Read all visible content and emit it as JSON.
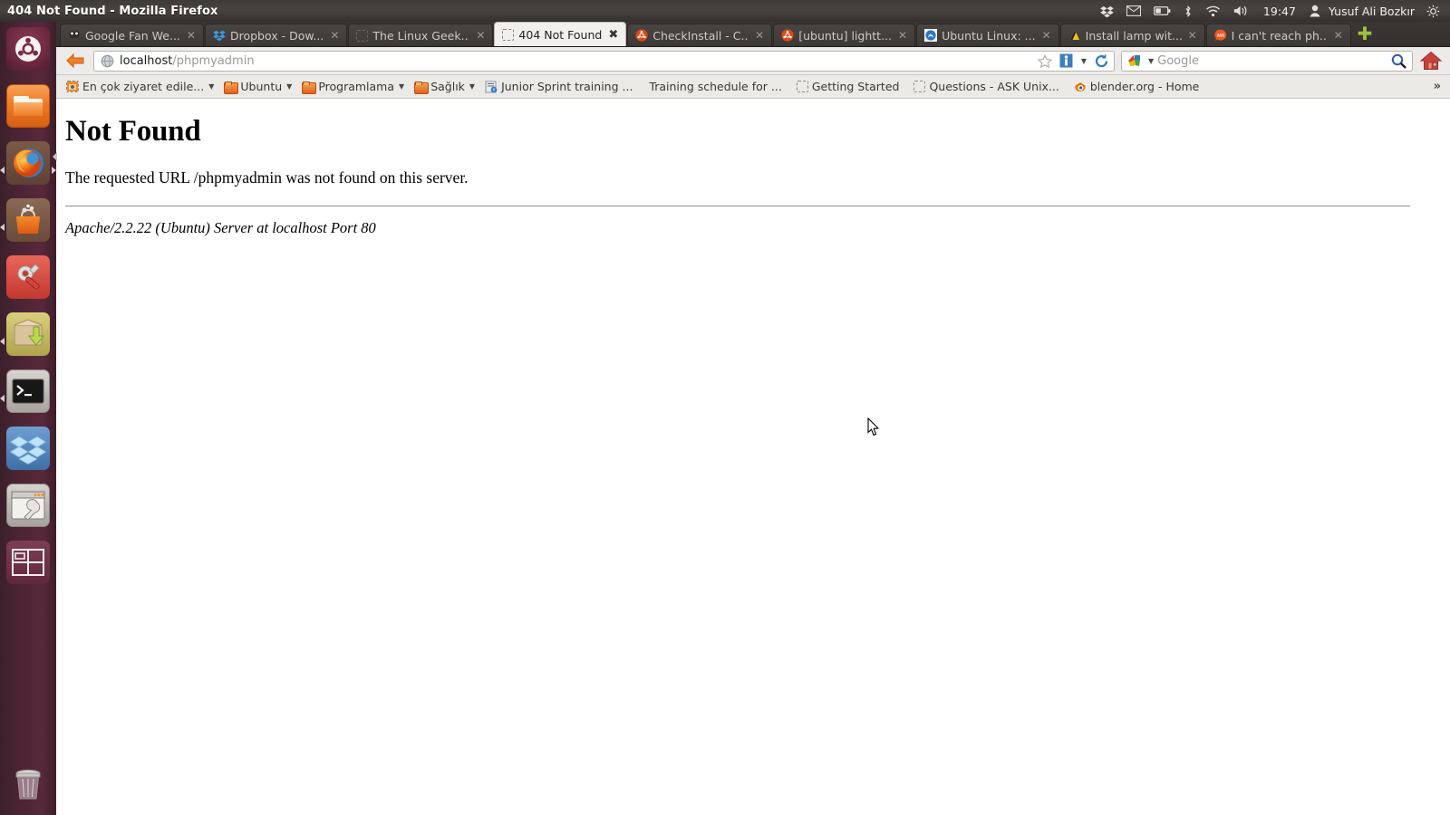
{
  "window": {
    "title": "404 Not Found - Mozilla Firefox"
  },
  "top_panel": {
    "clock": "19:47",
    "user": "Yusuf Ali Bozkır",
    "tray_icons": [
      {
        "name": "dropbox-icon",
        "glyph": "dropbox"
      },
      {
        "name": "mail-icon",
        "glyph": "envelope"
      },
      {
        "name": "battery-icon",
        "glyph": "battery"
      },
      {
        "name": "bluetooth-icon",
        "glyph": "bluetooth"
      },
      {
        "name": "wifi-icon",
        "glyph": "wifi"
      },
      {
        "name": "volume-icon",
        "glyph": "speaker"
      }
    ],
    "session_icon": "gear-icon",
    "user_icon": "user-icon"
  },
  "launcher": {
    "items": [
      {
        "name": "ubuntu-dash-icon",
        "label": "Dash home",
        "running": false
      },
      {
        "name": "files-icon",
        "label": "Files",
        "running": false
      },
      {
        "name": "firefox-icon",
        "label": "Firefox Web Browser",
        "running": true
      },
      {
        "name": "software-center-icon",
        "label": "Ubuntu Software Center",
        "running": true
      },
      {
        "name": "system-settings-icon",
        "label": "System Settings",
        "running": false
      },
      {
        "name": "ubuntu-one-icon",
        "label": "Ubuntu One",
        "running": true
      },
      {
        "name": "terminal-icon",
        "label": "Terminal",
        "running": true
      },
      {
        "name": "dropbox-icon",
        "label": "Dropbox",
        "running": false
      },
      {
        "name": "synaptic-icon",
        "label": "Synaptic Package Manager",
        "running": false
      },
      {
        "name": "workspace-switcher-icon",
        "label": "Workspace Switcher",
        "running": false
      }
    ],
    "trash": {
      "name": "trash-icon",
      "label": "Trash"
    }
  },
  "tabs": [
    {
      "label": "Google Fan We...",
      "favicon": "google-fan",
      "active": false
    },
    {
      "label": "Dropbox - Dow...",
      "favicon": "dropbox",
      "active": false
    },
    {
      "label": "The Linux Geek...",
      "favicon": "blank",
      "active": false
    },
    {
      "label": "404 Not Found",
      "favicon": "blank",
      "active": true
    },
    {
      "label": "CheckInstall - C...",
      "favicon": "ubuntu",
      "active": false
    },
    {
      "label": "[ubuntu] lightt...",
      "favicon": "ubuntu",
      "active": false
    },
    {
      "label": "Ubuntu Linux: ...",
      "favicon": "blue-swirl",
      "active": false
    },
    {
      "label": "Install lamp wit...",
      "favicon": "yellow",
      "active": false
    },
    {
      "label": "I can't reach ph...",
      "favicon": "askubuntu",
      "active": false
    }
  ],
  "tab_close_label": "✕",
  "active_tab_close_label": "✖",
  "new_tab_label": "✚",
  "navbar": {
    "back_icon": "back-arrow-icon",
    "site_icon": "globe-icon",
    "url_domain": "localhost",
    "url_path": "/phpmyadmin",
    "bookmark_star_icon": "star-icon",
    "identity_icon": "permissions-icon",
    "dropdown_icon": "chevron-down-icon",
    "reload_icon": "reload-icon",
    "home_icon": "home-icon",
    "search": {
      "engine_icon": "google-icon",
      "placeholder": "Google",
      "go_icon": "magnifier-icon"
    }
  },
  "bookmarks": {
    "items": [
      {
        "label": "En çok ziyaret edile...",
        "icon": "most-visited-icon",
        "has_caret": true
      },
      {
        "label": "Ubuntu",
        "icon": "folder-icon",
        "has_caret": true
      },
      {
        "label": "Programlama",
        "icon": "folder-icon",
        "has_caret": true
      },
      {
        "label": "Sağlık",
        "icon": "folder-icon",
        "has_caret": true
      },
      {
        "label": "Junior Sprint training ...",
        "icon": "document-icon",
        "has_caret": false
      },
      {
        "label": "Training schedule for ...",
        "icon": "none",
        "has_caret": false
      },
      {
        "label": "Getting Started",
        "icon": "blank-page-icon",
        "has_caret": false
      },
      {
        "label": "Questions - ASK Unix...",
        "icon": "blank-page-icon",
        "has_caret": false
      },
      {
        "label": "blender.org - Home",
        "icon": "blender-icon",
        "has_caret": false
      }
    ],
    "overflow_label": "»"
  },
  "page": {
    "heading": "Not Found",
    "paragraph": "The requested URL /phpmyadmin was not found on this server.",
    "address": "Apache/2.2.22 (Ubuntu) Server at localhost Port 80"
  },
  "colors": {
    "panel_bg": "#3f3b37",
    "launcher_bg": "#58283b",
    "tabbar_bg": "#3a3633",
    "toolbar_bg": "#edebe9",
    "active_tab_bg": "#f2f0ee",
    "ubuntu_orange": "#dd4814",
    "new_tab_green": "#9ac23f"
  }
}
